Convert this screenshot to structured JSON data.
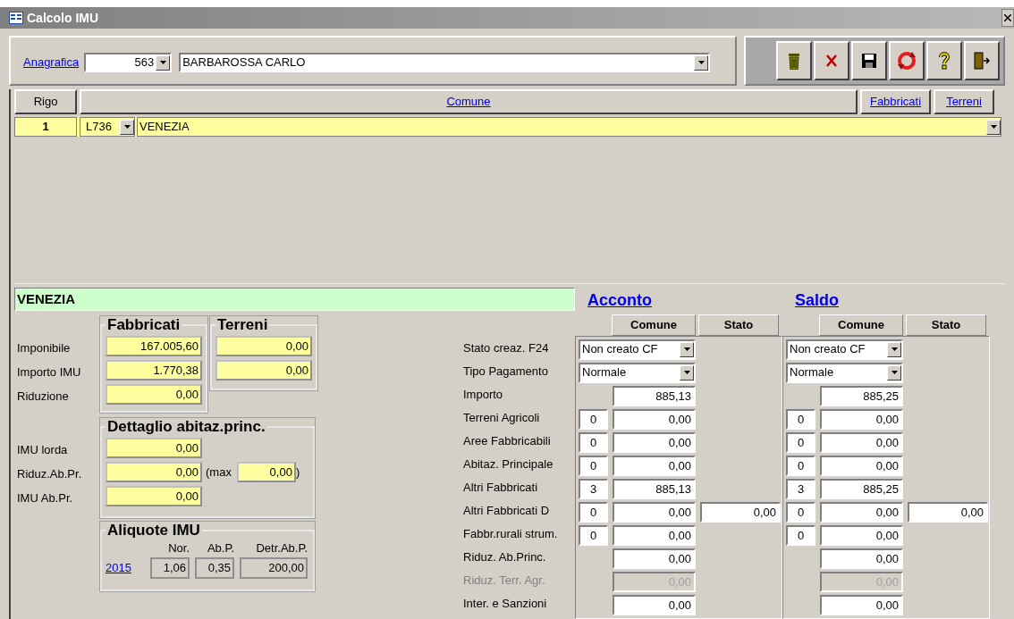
{
  "window": {
    "title": "Calcolo IMU"
  },
  "header": {
    "link": "Anagrafica",
    "code": "563",
    "name": "BARBAROSSA CARLO"
  },
  "grid": {
    "columns": [
      {
        "label": "Rigo",
        "kind": "plain"
      },
      {
        "label": "Comune",
        "kind": "link"
      },
      {
        "label": "Fabbricati",
        "kind": "link"
      },
      {
        "label": "Terreni",
        "kind": "link"
      }
    ],
    "rows": [
      {
        "rigo": "1",
        "code": "L736",
        "comune": "VENEZIA"
      }
    ]
  },
  "detail": {
    "title": "VENEZIA",
    "imposta": {
      "columns": [
        "Fabbricati",
        "Terreni"
      ],
      "rows": [
        {
          "label": "Imponibile",
          "fabbricati": "167.005,60",
          "terreni": "0,00"
        },
        {
          "label": "Importo IMU",
          "fabbricati": "1.770,38",
          "terreni": "0,00"
        },
        {
          "label": "Riduzione",
          "fabbricati": "0,00"
        }
      ]
    },
    "abitazione": {
      "title": "Dettaglio abitaz.princ.",
      "rows": [
        {
          "label": "IMU lorda",
          "value": "0,00"
        },
        {
          "label": "Riduz.Ab.Pr.",
          "value": "0,00",
          "max_open": "(max",
          "max_value": "0,00",
          "max_close": ")"
        },
        {
          "label": "IMU Ab.Pr.",
          "value": "0,00"
        }
      ]
    },
    "aliquote": {
      "title": "Aliquote IMU",
      "year": "2015",
      "columns": [
        "Nor.",
        "Ab.P.",
        "Detr.Ab.P."
      ],
      "values": [
        "1,06",
        "0,35",
        "200,00"
      ]
    }
  },
  "payments": {
    "sections": [
      {
        "title": "Acconto",
        "columns": [
          "Comune",
          "Stato"
        ]
      },
      {
        "title": "Saldo",
        "columns": [
          "Comune",
          "Stato"
        ]
      }
    ],
    "rows": [
      {
        "label": "Stato creaz. F24",
        "kind": "select",
        "disabled": false,
        "values": [
          {
            "select": "Non creato CF"
          },
          {
            "select": "Non creato CF"
          }
        ]
      },
      {
        "label": "Tipo Pagamento",
        "kind": "select",
        "disabled": false,
        "values": [
          {
            "select": "Normale"
          },
          {
            "select": "Normale"
          }
        ]
      },
      {
        "label": "Importo",
        "kind": "amount",
        "disabled": false,
        "values": [
          {
            "comune": "885,13"
          },
          {
            "comune": "885,25"
          }
        ]
      },
      {
        "label": "Terreni Agricoli",
        "kind": "count_amount",
        "disabled": false,
        "values": [
          {
            "count": "0",
            "comune": "0,00"
          },
          {
            "count": "0",
            "comune": "0,00"
          }
        ]
      },
      {
        "label": "Aree Fabbricabili",
        "kind": "count_amount",
        "disabled": false,
        "values": [
          {
            "count": "0",
            "comune": "0,00"
          },
          {
            "count": "0",
            "comune": "0,00"
          }
        ]
      },
      {
        "label": "Abitaz. Principale",
        "kind": "count_amount",
        "disabled": false,
        "values": [
          {
            "count": "0",
            "comune": "0,00"
          },
          {
            "count": "0",
            "comune": "0,00"
          }
        ]
      },
      {
        "label": "Altri Fabbricati",
        "kind": "count_amount",
        "disabled": false,
        "values": [
          {
            "count": "3",
            "comune": "885,13"
          },
          {
            "count": "3",
            "comune": "885,25"
          }
        ]
      },
      {
        "label": "Altri Fabbricati D",
        "kind": "count_amount",
        "disabled": false,
        "values": [
          {
            "count": "0",
            "comune": "0,00",
            "stato": "0,00"
          },
          {
            "count": "0",
            "comune": "0,00",
            "stato": "0,00"
          }
        ]
      },
      {
        "label": "Fabbr.rurali strum.",
        "kind": "count_amount",
        "disabled": false,
        "values": [
          {
            "count": "0",
            "comune": "0,00"
          },
          {
            "count": "0",
            "comune": "0,00"
          }
        ]
      },
      {
        "label": "Riduz. Ab.Princ.",
        "kind": "amount",
        "disabled": false,
        "values": [
          {
            "comune": "0,00"
          },
          {
            "comune": "0,00"
          }
        ]
      },
      {
        "label": "Riduz. Terr. Agr.",
        "kind": "amount",
        "disabled": true,
        "values": [
          {
            "comune": "0,00"
          },
          {
            "comune": "0,00"
          }
        ]
      },
      {
        "label": "Inter. e Sanzioni",
        "kind": "amount",
        "disabled": false,
        "values": [
          {
            "comune": "0,00"
          },
          {
            "comune": "0,00"
          }
        ]
      }
    ]
  }
}
